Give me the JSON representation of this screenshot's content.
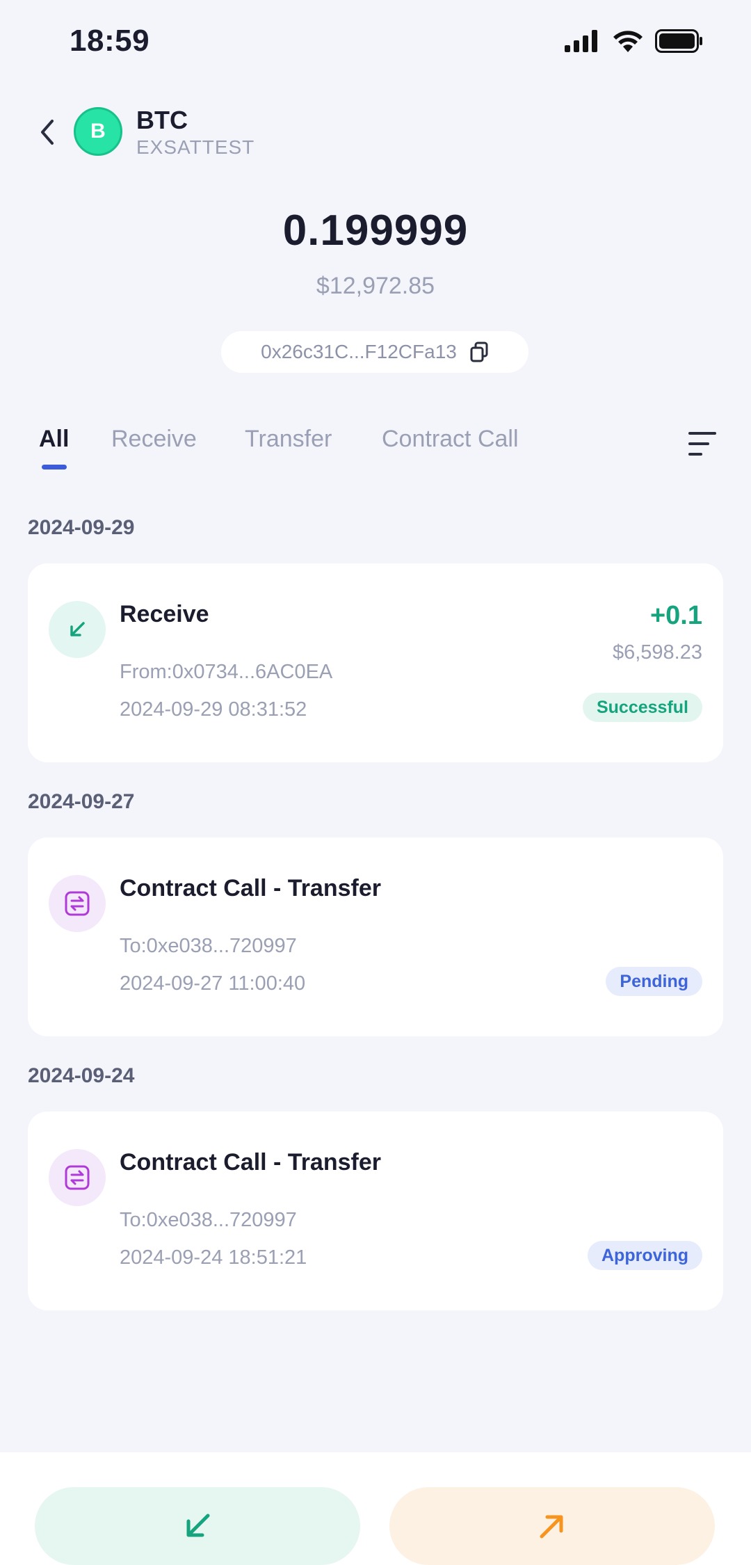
{
  "status_bar": {
    "time": "18:59",
    "icons": [
      "signal-icon",
      "wifi-icon",
      "battery-icon"
    ]
  },
  "header": {
    "back_icon": "chevron-left-icon",
    "avatar_letter": "B",
    "symbol": "BTC",
    "network": "EXSATTEST"
  },
  "balance": {
    "amount": "0.199999",
    "fiat": "$12,972.85",
    "address": "0x26c31C...F12CFa13",
    "copy_icon": "copy-icon"
  },
  "tabs": [
    {
      "label": "All",
      "active": true
    },
    {
      "label": "Receive",
      "active": false
    },
    {
      "label": "Transfer",
      "active": false
    },
    {
      "label": "Contract Call",
      "active": false
    }
  ],
  "filter_icon": "menu-lines-icon",
  "groups": [
    {
      "date": "2024-09-29",
      "tx": {
        "type": "receive",
        "icon": "arrow-down-left-icon",
        "title": "Receive",
        "line1": "From:0x0734...6AC0EA",
        "line2": "2024-09-29 08:31:52",
        "amount": "+0.1",
        "fiat": "$6,598.23",
        "status": "Successful"
      }
    },
    {
      "date": "2024-09-27",
      "tx": {
        "type": "contract",
        "icon": "swap-icon",
        "title": "Contract Call - Transfer",
        "line1": "To:0xe038...720997",
        "line2": "2024-09-27 11:00:40",
        "status": "Pending"
      }
    },
    {
      "date": "2024-09-24",
      "tx": {
        "type": "contract",
        "icon": "swap-icon",
        "title": "Contract Call - Transfer",
        "line1": "To:0xe038...720997",
        "line2": "2024-09-24 18:51:21",
        "status": "Approving"
      }
    }
  ],
  "actions": {
    "receive_icon": "arrow-down-left-icon",
    "send_icon": "arrow-up-right-icon"
  },
  "colors": {
    "accent": "#3b5bdb",
    "positive": "#16a47e",
    "coin": "#27e3a6",
    "send": "#f7941d"
  }
}
